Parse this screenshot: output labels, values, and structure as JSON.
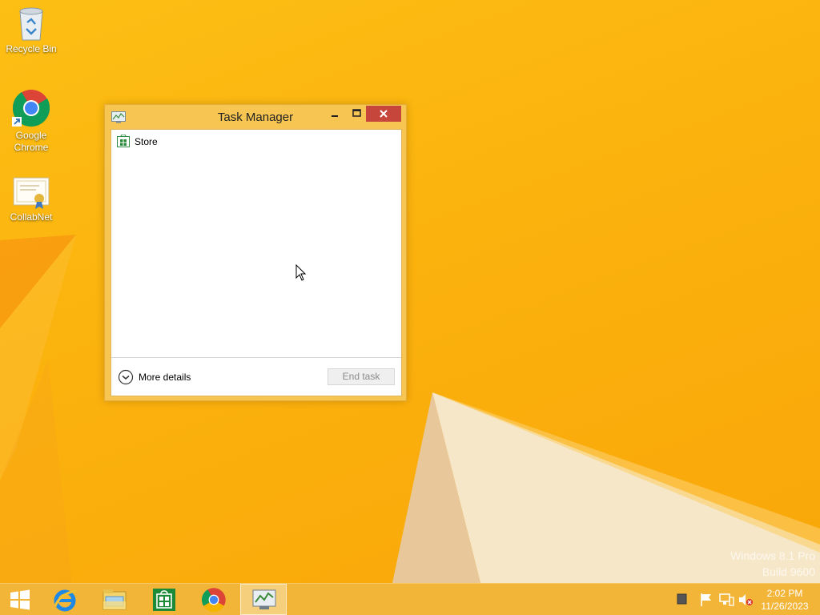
{
  "desktop": {
    "icons": [
      {
        "label": "Recycle Bin",
        "icon": "recycle-bin-icon"
      },
      {
        "label": "Google\nChrome",
        "icon": "chrome-icon"
      },
      {
        "label": "CollabNet",
        "icon": "certificate-icon"
      }
    ],
    "watermark": {
      "line1": "Windows 8.1 Pro",
      "line2": "Build 9600"
    }
  },
  "task_manager": {
    "title": "Task Manager",
    "processes": [
      {
        "name": "Store",
        "icon": "store-icon"
      }
    ],
    "more_details_label": "More details",
    "end_task_label": "End task"
  },
  "taskbar": {
    "apps": [
      "start-button",
      "internet-explorer",
      "file-explorer",
      "store",
      "chrome",
      "task-manager"
    ],
    "clock": {
      "time": "2:02 PM",
      "date": "11/26/2023"
    }
  },
  "colors": {
    "desktop": "#fbb20d",
    "window_frame": "#f6c552",
    "close_button": "#c7463b",
    "taskbar": "#f2b538"
  }
}
